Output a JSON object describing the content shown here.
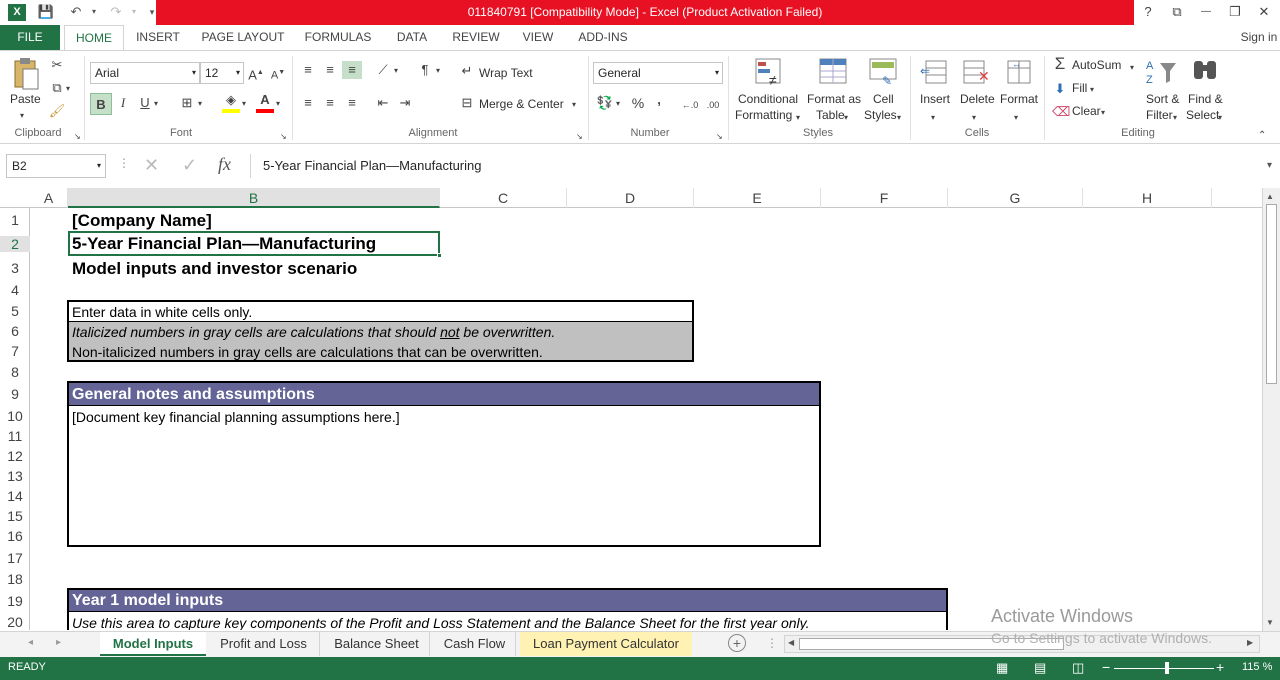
{
  "titlebar": {
    "title": "011840791  [Compatibility Mode] -  Excel (Product Activation Failed)",
    "help": "?",
    "restore_ribbon": "⧉",
    "minimize": "—",
    "maximize": "❐",
    "close": "✕"
  },
  "tabs": [
    "FILE",
    "HOME",
    "INSERT",
    "PAGE LAYOUT",
    "FORMULAS",
    "DATA",
    "REVIEW",
    "VIEW",
    "ADD-INS"
  ],
  "signin": "Sign in",
  "ribbon": {
    "clipboard": {
      "paste": "Paste",
      "label": "Clipboard"
    },
    "font": {
      "name": "Arial",
      "size": "12",
      "bold": "B",
      "italic": "I",
      "underline": "U",
      "label": "Font"
    },
    "alignment": {
      "wrap": "Wrap Text",
      "merge": "Merge & Center",
      "label": "Alignment"
    },
    "number": {
      "format": "General",
      "percent": "%",
      "comma": ",",
      "label": "Number"
    },
    "styles": {
      "conditional": "Conditional",
      "conditional2": "Formatting",
      "format_table": "Format as",
      "format_table2": "Table",
      "cell_styles": "Cell",
      "cell_styles2": "Styles",
      "label": "Styles"
    },
    "cells": {
      "insert": "Insert",
      "delete": "Delete",
      "format": "Format",
      "label": "Cells"
    },
    "editing": {
      "autosum": "AutoSum",
      "fill": "Fill",
      "clear": "Clear",
      "sort": "Sort &",
      "sort2": "Filter",
      "find": "Find &",
      "find2": "Select",
      "label": "Editing"
    }
  },
  "formula_bar": {
    "namebox": "B2",
    "fx": "fx",
    "formula": "5-Year Financial Plan—Manufacturing"
  },
  "columns": [
    "A",
    "B",
    "C",
    "D",
    "E",
    "F",
    "G",
    "H"
  ],
  "rows": [
    "1",
    "2",
    "3",
    "4",
    "5",
    "6",
    "7",
    "8",
    "9",
    "10",
    "11",
    "12",
    "13",
    "14",
    "15",
    "16",
    "17",
    "18",
    "19",
    "20"
  ],
  "cells": {
    "b1": "[Company Name]",
    "b2": "5-Year Financial Plan—Manufacturing",
    "b3": "Model inputs and investor scenario",
    "b5": "Enter data in white cells only.",
    "b6_a": "Italicized numbers in gray cells are calculations that should ",
    "b6_b": "not",
    "b6_c": " be overwritten.",
    "b7": "Non-italicized numbers in gray cells are calculations that can be overwritten.",
    "b9": "General notes and assumptions",
    "b10": "[Document key financial planning assumptions here.]",
    "b19": "Year 1 model inputs",
    "b20": "Use this area to capture key components of the Profit and Loss Statement and the Balance Sheet for the first year only."
  },
  "watermark": {
    "line1": "Activate Windows",
    "line2": "Go to Settings to activate Windows."
  },
  "sheets": [
    "Model Inputs",
    "Profit and Loss",
    "Balance Sheet",
    "Cash Flow",
    "Loan Payment Calculator"
  ],
  "status": {
    "ready": "READY",
    "zoom": "115 %"
  },
  "colors": {
    "excel_green": "#217346",
    "header_purple": "#646496",
    "title_red": "#e81123",
    "gray_cell": "#c0c0c0"
  }
}
